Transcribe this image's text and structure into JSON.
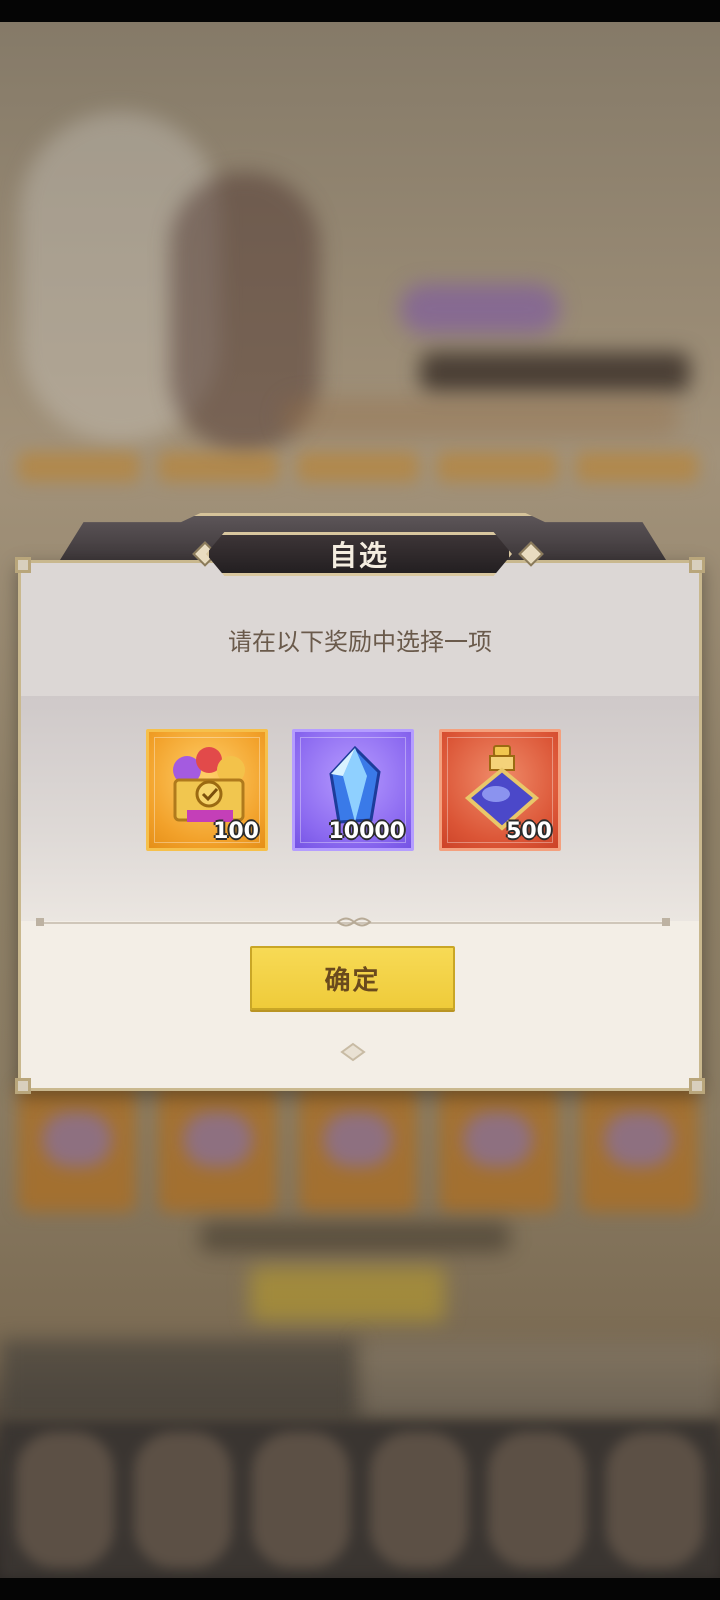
{
  "modal": {
    "title": "自选",
    "prompt": "请在以下奖励中选择一项",
    "confirm_label": "确定",
    "items": [
      {
        "icon": "chest-icon",
        "quantity": "100",
        "rarity_color": "#F2A12A"
      },
      {
        "icon": "crystal-icon",
        "quantity": "10000",
        "rarity_color": "#8B69F0"
      },
      {
        "icon": "potion-icon",
        "quantity": "500",
        "rarity_color": "#DB5536"
      }
    ]
  },
  "colors": {
    "confirm_button": "#EFCB3A",
    "title_plate": "#2A2426",
    "frame_gold": "#D6C39A"
  }
}
